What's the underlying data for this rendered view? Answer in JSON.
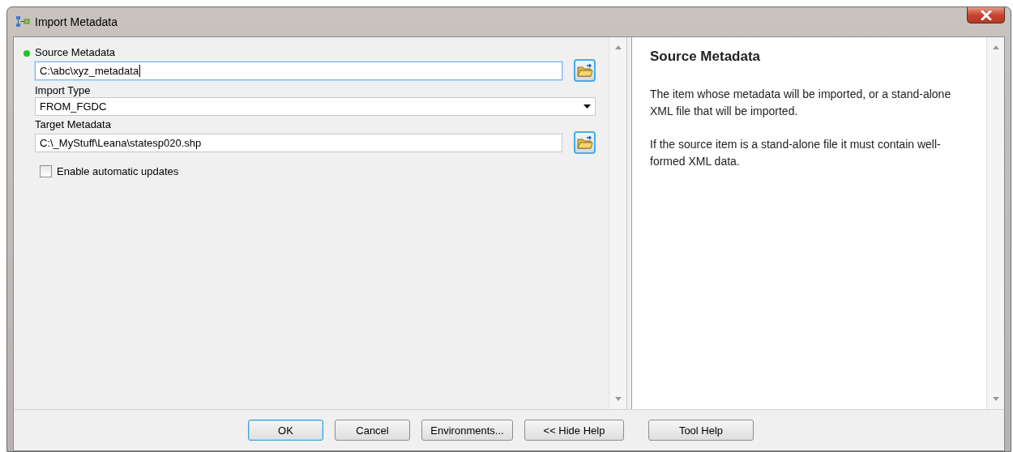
{
  "window": {
    "title": "Import Metadata"
  },
  "fields": [
    {
      "kind": "text",
      "label": "Source Metadata",
      "required": true,
      "value": "C:\\abc\\xyz_metadata",
      "focused": true
    },
    {
      "kind": "dropdown",
      "label": "Import Type",
      "required": false,
      "value": "FROM_FGDC",
      "focused": false
    },
    {
      "kind": "text",
      "label": "Target Metadata",
      "required": false,
      "value": "C:\\_MyStuff\\Leana\\statesp020.shp",
      "focused": false
    }
  ],
  "checkbox": {
    "label": "Enable automatic updates",
    "checked": false
  },
  "help": {
    "title": "Source Metadata",
    "paragraphs": [
      "The item whose metadata will be imported, or a stand-alone XML file that will be imported.",
      "If the source item is a stand-alone file it must contain well-formed XML data."
    ]
  },
  "buttons": [
    {
      "label": "OK",
      "default": true
    },
    {
      "label": "Cancel",
      "default": false
    },
    {
      "label": "Environments...",
      "default": false
    },
    {
      "label": "<< Hide Help",
      "default": false
    },
    {
      "label": "Tool Help",
      "default": false
    }
  ]
}
